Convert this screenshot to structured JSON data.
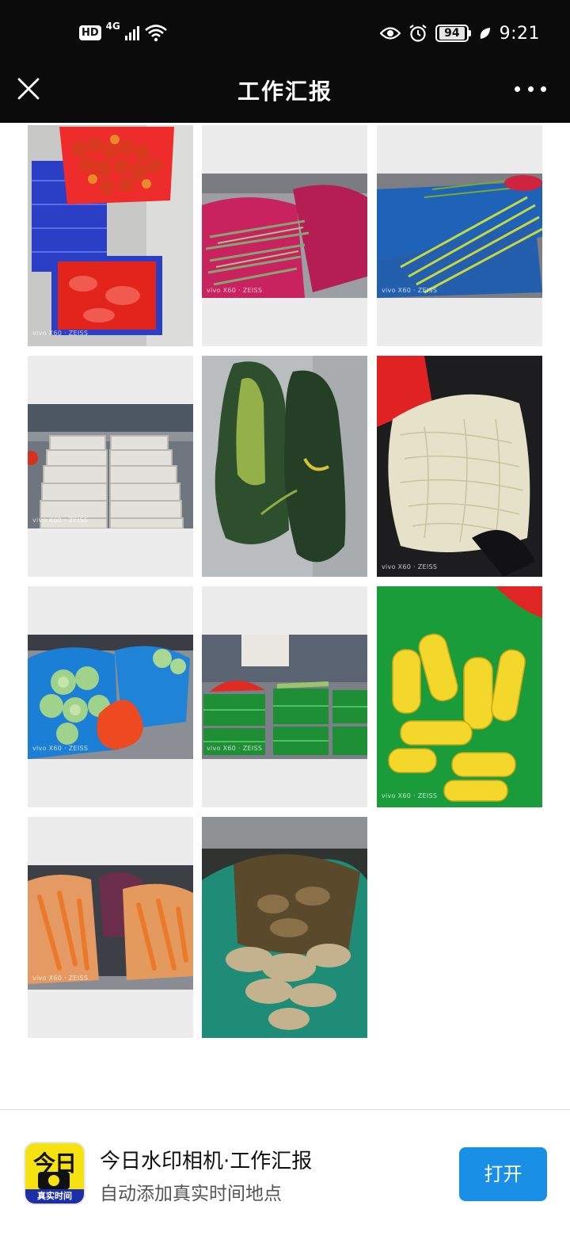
{
  "status_bar": {
    "hd_label": "HD",
    "network_label": "4G",
    "battery_level": "94",
    "time": "9:21"
  },
  "title_bar": {
    "title": "工作汇报"
  },
  "photos": [
    {
      "subject": "tomatoes in crates",
      "watermark": "vivo X60 · ZEISS"
    },
    {
      "subject": "green beans",
      "watermark": "vivo X60 · ZEISS"
    },
    {
      "subject": "green onions",
      "watermark": "vivo X60 · ZEISS"
    },
    {
      "subject": "tofu trays",
      "watermark": "vivo X60 · ZEISS"
    },
    {
      "subject": "winter melons",
      "watermark": ""
    },
    {
      "subject": "bean sprouts",
      "watermark": "vivo X60 · ZEISS"
    },
    {
      "subject": "cabbage",
      "watermark": "vivo X60 · ZEISS"
    },
    {
      "subject": "vegetable baskets",
      "watermark": "vivo X60 · ZEISS"
    },
    {
      "subject": "corn",
      "watermark": "vivo X60 · ZEISS"
    },
    {
      "subject": "carrots",
      "watermark": "vivo X60 · ZEISS"
    },
    {
      "subject": "ginger",
      "watermark": ""
    }
  ],
  "app_banner": {
    "logo_text": "今日",
    "logo_subtext": "真实时间",
    "title": "今日水印相机·工作汇报",
    "subtitle": "自动添加真实时间地点",
    "open_label": "打开",
    "accent_color": "#1a8fe6",
    "logo_color": "#f6e211"
  }
}
